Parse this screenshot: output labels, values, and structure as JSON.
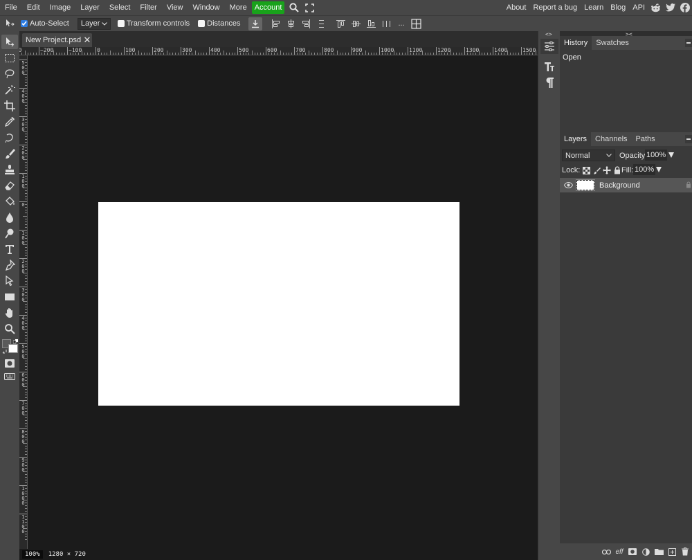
{
  "menubar": {
    "items": [
      "File",
      "Edit",
      "Image",
      "Layer",
      "Select",
      "Filter",
      "View",
      "Window",
      "More"
    ],
    "account_label": "Account",
    "right_links": [
      "About",
      "Report a bug",
      "Learn",
      "Blog",
      "API"
    ],
    "accent_color": "#19a21b"
  },
  "options": {
    "auto_select_label": "Auto-Select",
    "auto_select_checked": true,
    "target_select_value": "Layer",
    "transform_controls_label": "Transform controls",
    "transform_controls_checked": false,
    "distances_label": "Distances",
    "distances_checked": false,
    "more_label": "..."
  },
  "document": {
    "tab_title": "New Project.psd",
    "zoom": "100%",
    "dimensions": "1280 × 720",
    "canvas_color": "#ffffff"
  },
  "ruler": {
    "top_labels": [
      "300",
      "−200",
      "−100",
      "0",
      "100",
      "200",
      "300",
      "400",
      "500",
      "600",
      "700",
      "800",
      "900",
      "1000",
      "1100",
      "1200",
      "1300",
      "1400",
      "1500"
    ],
    "left_labels": [
      "500",
      "400",
      "300",
      "200",
      "100",
      "0",
      "100",
      "200",
      "300",
      "400",
      "500",
      "600",
      "700",
      "800",
      "900",
      "1000",
      "1100"
    ]
  },
  "mini_panel": {
    "collapse_left": "<>",
    "collapse_right": "><"
  },
  "history_panel": {
    "tabs": [
      "History",
      "Swatches"
    ],
    "items": [
      "Open"
    ]
  },
  "layers_panel": {
    "tabs": [
      "Layers",
      "Channels",
      "Paths"
    ],
    "blend_mode": "Normal",
    "opacity_label": "Opacity:",
    "opacity_value": "100%",
    "lock_label": "Lock:",
    "fill_label": "Fill:",
    "fill_value": "100%",
    "layers": [
      {
        "name": "Background",
        "visible": true,
        "locked": true
      }
    ],
    "footer_icons": [
      "link-layers-icon",
      "effects-icon",
      "mask-icon",
      "adjustment-icon",
      "folder-icon",
      "new-layer-icon",
      "delete-icon"
    ],
    "effects_label": "eff"
  }
}
